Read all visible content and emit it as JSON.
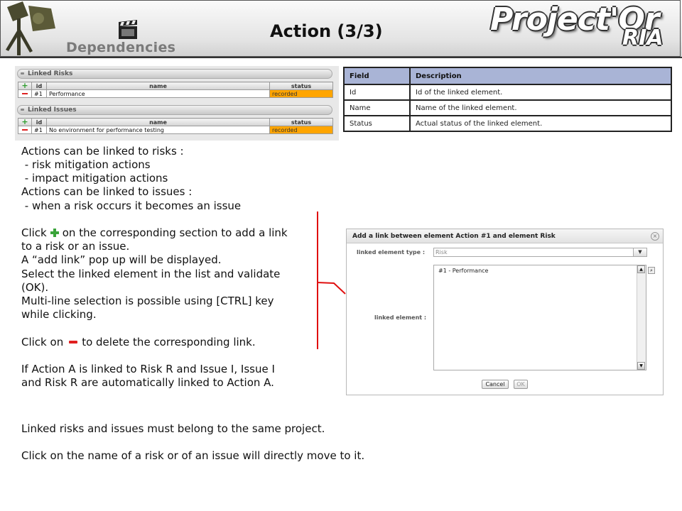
{
  "header": {
    "section_label": "Dependencies",
    "page_title": "Action (3/3)",
    "brand": "Project'Or",
    "brand_sub": "RIA"
  },
  "linked_risks": {
    "title": "Linked Risks",
    "columns": [
      "id",
      "name",
      "status"
    ],
    "rows": [
      {
        "id": "#1",
        "name": "Performance",
        "status": "recorded"
      }
    ]
  },
  "linked_issues": {
    "title": "Linked Issues",
    "columns": [
      "id",
      "name",
      "status"
    ],
    "rows": [
      {
        "id": "#1",
        "name": "No environment for performance testing",
        "status": "recorded"
      }
    ]
  },
  "field_table": {
    "headers": [
      "Field",
      "Description"
    ],
    "rows": [
      {
        "field": "Id",
        "description": "Id of the linked element."
      },
      {
        "field": "Name",
        "description": "Name of the linked element."
      },
      {
        "field": "Status",
        "description": "Actual status of the linked element."
      }
    ]
  },
  "text": {
    "l1": "Actions can be linked to risks :",
    "l2": " - risk mitigation actions",
    "l3": " - impact mitigation actions",
    "l4": "Actions can be linked to issues :",
    "l5": " - when a risk occurs it becomes an issue",
    "l6a": "Click",
    "l6b": "on the corresponding section to add a link",
    "l7": "to a risk or an issue.",
    "l8": "A “add link” pop up will be displayed.",
    "l9": "Select the linked element in the list and validate",
    "l10": "(OK).",
    "l11": "Multi-line selection is possible using [CTRL] key",
    "l12": "while clicking.",
    "l13a": "Click on",
    "l13b": "to delete the corresponding link.",
    "l14": "If Action A is linked to Risk R and Issue I, Issue I",
    "l15": "and Risk R are automatically linked to Action A.",
    "l16": "Linked risks and issues must belong to the same project.",
    "l17": "Click on the name of a risk or of an issue will directly move to it."
  },
  "dialog": {
    "title": "Add a link between element Action #1 and element Risk",
    "type_label": "linked element type :",
    "type_value": "Risk",
    "element_label": "linked element :",
    "list_items": [
      "#1 - Performance"
    ],
    "cancel_label": "Cancel",
    "ok_label": "OK"
  },
  "colors": {
    "status_recorded": "#ffa500",
    "table_header": "#a9b4d6",
    "accent_red": "#e01010",
    "add_green": "#3aa43a"
  },
  "icons": {
    "add": "plus-icon",
    "remove": "minus-icon",
    "close": "close-icon",
    "search": "search-icon"
  }
}
